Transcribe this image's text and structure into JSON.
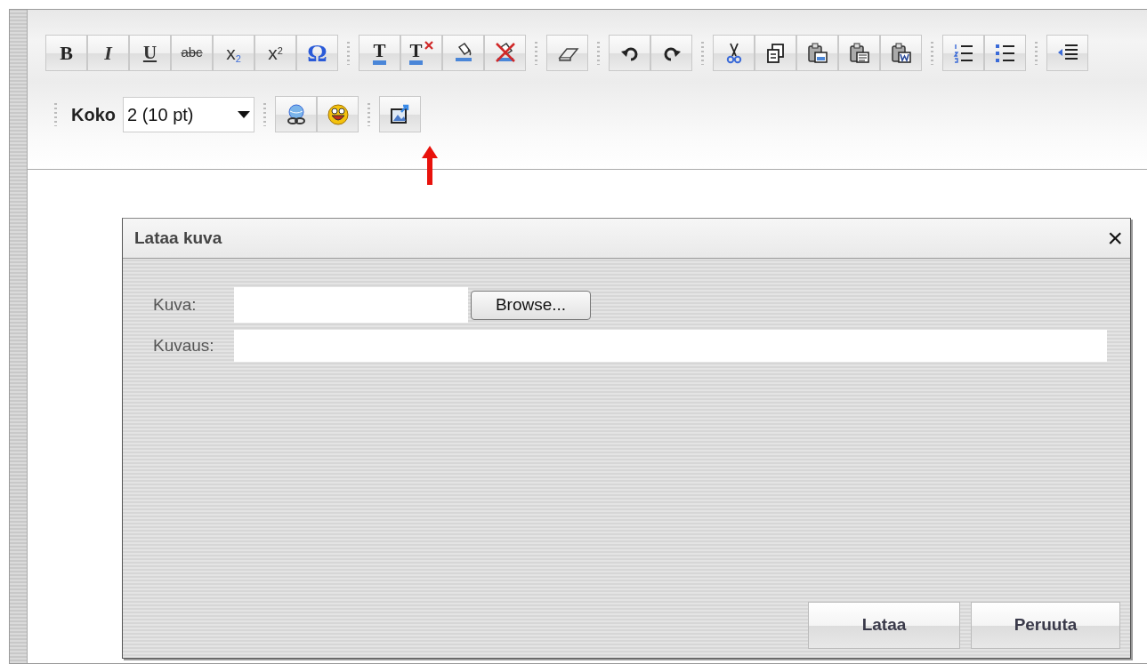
{
  "toolbar": {
    "rows": [
      [
        {
          "items": [
            {
              "kind": "bold",
              "label": "B"
            },
            {
              "kind": "italic",
              "label": "I"
            },
            {
              "kind": "underline",
              "label": "U"
            },
            {
              "kind": "strike",
              "label": "abc"
            },
            {
              "kind": "subscript",
              "label": "x$_{2}$"
            },
            {
              "kind": "superscript",
              "label": "x$^{2}$"
            },
            {
              "kind": "symbol",
              "label": "Ω"
            }
          ]
        },
        {
          "items": [
            {
              "kind": "text-color",
              "label": "T"
            },
            {
              "kind": "text-color-remove",
              "label": "T"
            },
            {
              "kind": "fill-color"
            },
            {
              "kind": "fill-color-remove"
            }
          ]
        },
        {
          "items": [
            {
              "kind": "eraser"
            }
          ]
        },
        {
          "items": [
            {
              "kind": "undo"
            },
            {
              "kind": "redo"
            }
          ]
        },
        {
          "items": [
            {
              "kind": "cut"
            },
            {
              "kind": "copy"
            },
            {
              "kind": "paste"
            },
            {
              "kind": "paste-text"
            },
            {
              "kind": "paste-word"
            }
          ]
        },
        {
          "items": [
            {
              "kind": "ordered-list"
            },
            {
              "kind": "bullet-list"
            }
          ]
        },
        {
          "items": [
            {
              "kind": "outdent"
            }
          ]
        }
      ],
      [
        {
          "items": [
            {
              "kind": "label",
              "label": "Koko"
            },
            {
              "kind": "select",
              "value": "2 (10 pt)"
            }
          ]
        },
        {
          "items": [
            {
              "kind": "link"
            },
            {
              "kind": "smiley"
            }
          ]
        },
        {
          "items": [
            {
              "kind": "image"
            }
          ]
        }
      ]
    ]
  },
  "dialog": {
    "title": "Lataa kuva",
    "close": "×",
    "fields": [
      {
        "kind": "file",
        "label": "Kuva:",
        "button": "Browse..."
      },
      {
        "kind": "text",
        "label": "Kuvaus:"
      }
    ],
    "buttons": [
      "Lataa",
      "Peruuta"
    ]
  }
}
